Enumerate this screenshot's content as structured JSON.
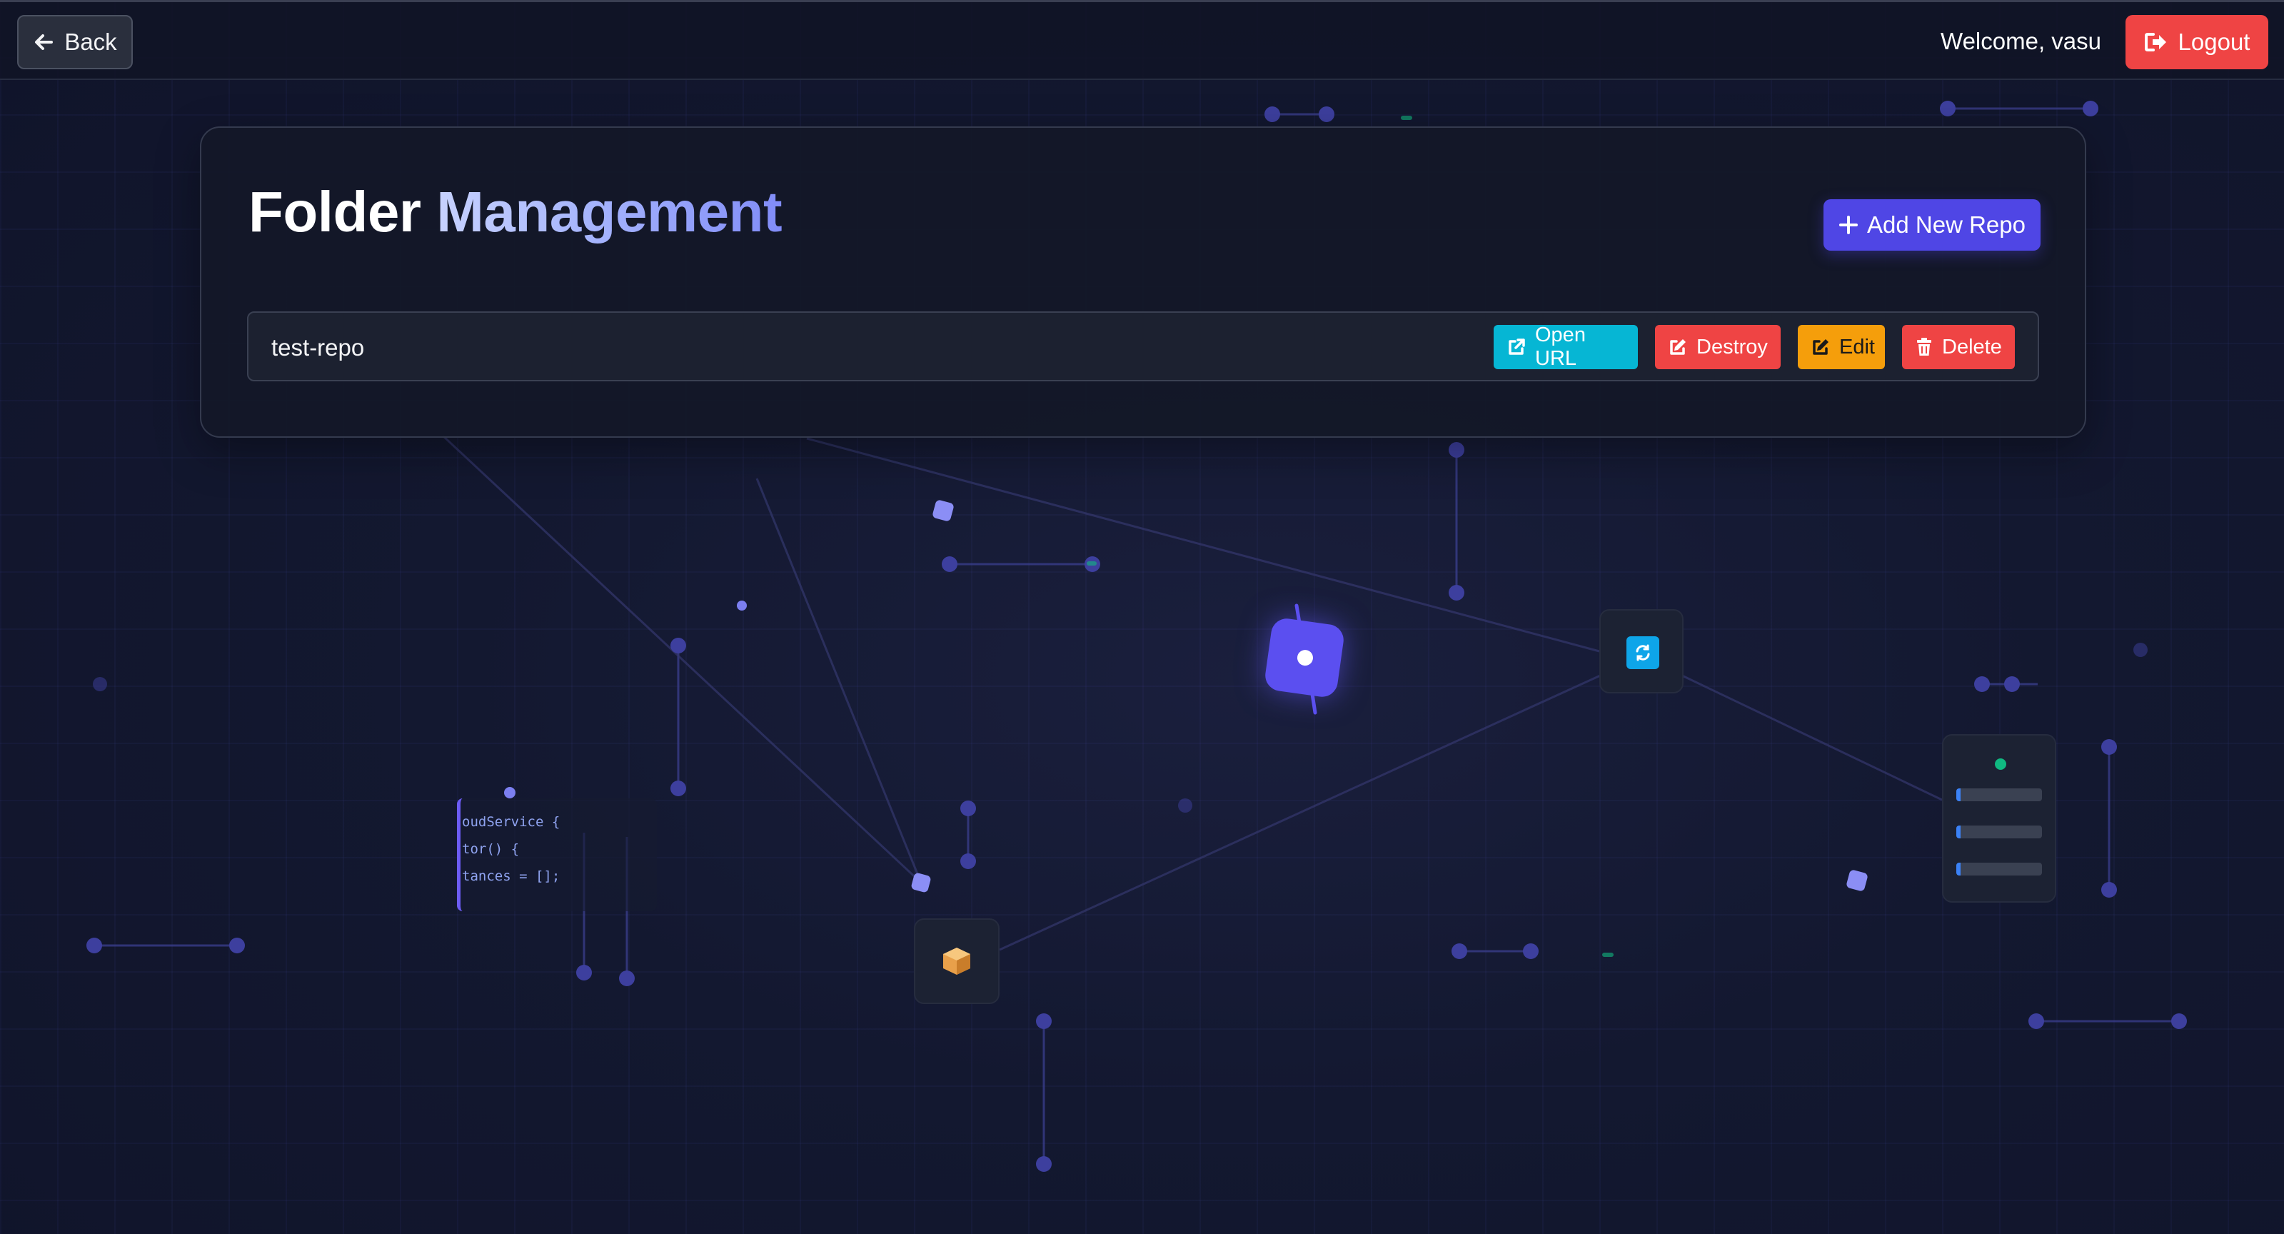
{
  "header": {
    "back_label": "Back",
    "welcome_text": "Welcome, vasu",
    "logout_label": "Logout"
  },
  "page": {
    "title_part1": "Folder",
    "title_part2": "Management",
    "add_repo_label": "Add New Repo"
  },
  "repos": [
    {
      "name": "test-repo",
      "actions": {
        "open_url": "Open URL",
        "destroy": "Destroy",
        "edit": "Edit",
        "delete": "Delete"
      }
    }
  ],
  "decor": {
    "code_lines": [
      "oudService {",
      "tor() {",
      "tances = [];"
    ]
  },
  "colors": {
    "background": "#121729",
    "accent": "#4f46e5",
    "danger": "#ef4444",
    "info": "#06b6d4",
    "warning": "#f59e0b"
  },
  "icons": {
    "back": "arrow-left-icon",
    "logout": "sign-out-icon",
    "add": "plus-icon",
    "open_url": "external-link-icon",
    "destroy": "edit-icon",
    "edit": "edit-icon",
    "delete": "trash-icon"
  }
}
